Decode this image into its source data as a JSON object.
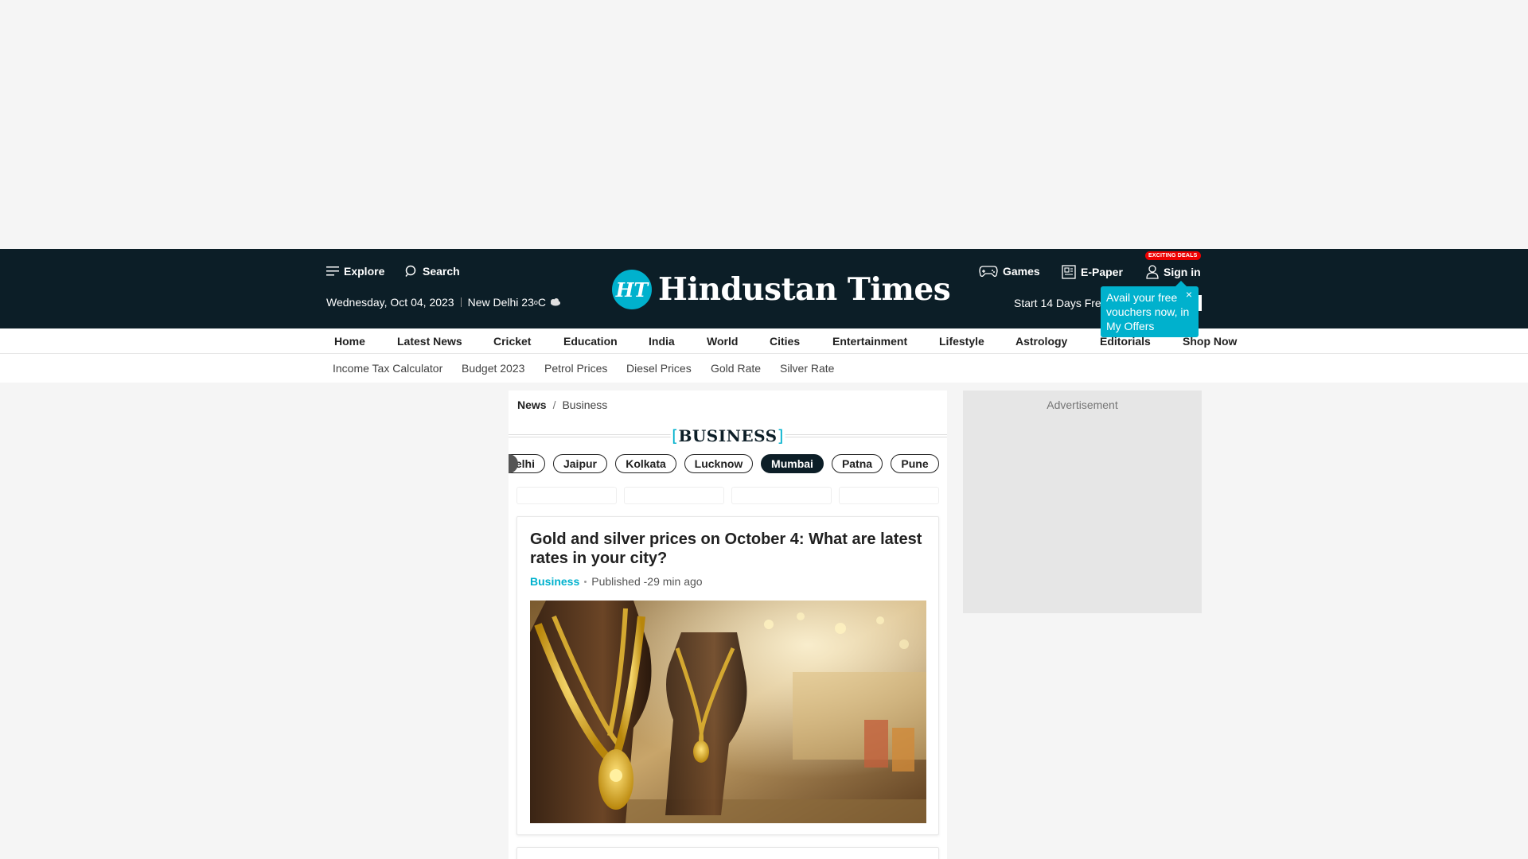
{
  "header": {
    "explore_label": "Explore",
    "search_label": "Search",
    "date": "Wednesday, Oct 04, 2023",
    "city_temp": "New Delhi 23",
    "temp_unit_sup": "o",
    "temp_unit": "C",
    "logo_mark": "HT",
    "logo_text": "Hindustan Times",
    "games_label": "Games",
    "epaper_label": "E-Paper",
    "signin_label": "Sign in",
    "deals_badge": "EXCITING DEALS",
    "trial_text": "Start 14 Days Fre",
    "offer_tooltip": "Avail your free vouchers now, in My Offers",
    "offer_close": "×"
  },
  "nav": {
    "items": [
      "Home",
      "Latest News",
      "Cricket",
      "Education",
      "India",
      "World",
      "Cities",
      "Entertainment",
      "Lifestyle",
      "Astrology",
      "Editorials",
      "Shop Now"
    ]
  },
  "subnav": {
    "items": [
      "Income Tax Calculator",
      "Budget 2023",
      "Petrol Prices",
      "Diesel Prices",
      "Gold Rate",
      "Silver Rate"
    ]
  },
  "breadcrumb": {
    "home": "News",
    "separator": "/",
    "current": "Business"
  },
  "section": {
    "title": "BUSINESS",
    "open_bracket": "[",
    "close_bracket": "]"
  },
  "city_chips": {
    "items": [
      "Delhi",
      "Jaipur",
      "Kolkata",
      "Lucknow",
      "Mumbai",
      "Patna",
      "Pune"
    ],
    "active": "Mumbai"
  },
  "article": {
    "title": "Gold and silver prices on October 4: What are latest rates in your city?",
    "section": "Business",
    "published": "Published -29 min ago"
  },
  "ad": {
    "label": "Advertisement"
  },
  "colors": {
    "header_bg": "#0c1e27",
    "accent": "#00b1cd",
    "badge_red": "#e00000"
  }
}
